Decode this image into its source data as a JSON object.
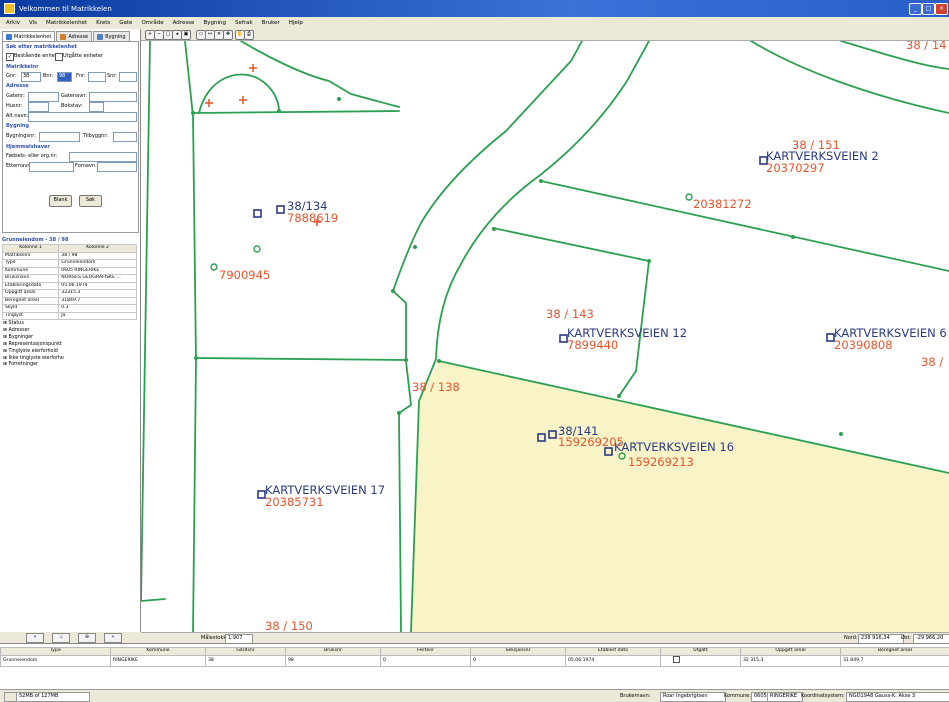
{
  "titlebar": {
    "title": "Velkommen til Matrikkelen"
  },
  "menu": [
    "Arkiv",
    "Vis",
    "Matrikkelenhet",
    "Krets",
    "Gate",
    "Område",
    "Adresse",
    "Bygning",
    "Sefrak",
    "Bruker",
    "Hjelp"
  ],
  "tabs": [
    "Matrikkelenhet",
    "Adresse",
    "Bygning"
  ],
  "search": {
    "heading": "Søk etter matrikkelenhet",
    "opt_existing": "Bestående enheter",
    "opt_expired": "Utgåtte enheter",
    "matrikkel_head": "Matrikkelnr",
    "gnr_label": "Gnr:",
    "gnr_value": "38",
    "bnr_label": "Bnr:",
    "bnr_value": "98",
    "fnr_label": "Fnr:",
    "snr_label": "Snr:",
    "adresse_head": "Adresse",
    "gatenr_label": "Gatenr:",
    "gatenavn_label": "Gatenavn:",
    "husnr_label": "Husnr:",
    "bokstav_label": "Bokstav:",
    "altnavn_label": "Alt.navn:",
    "bygning_head": "Bygning",
    "bygningsnr_label": "Bygningsnr:",
    "tilbygg_label": "Tilbyggnr:",
    "hjemmelshaver_head": "Hjemmelshaver",
    "fodsels_label": "Fødsels- eller org.nr:",
    "etternavn_label": "Etternavn:",
    "fornavn_label": "Fornavn:",
    "blank_button": "Blank",
    "search_button": "Søk"
  },
  "result": {
    "header": "Grunneiendom - 38 / 98",
    "col1": "Kolonne 1",
    "col2": "Kolonne 2",
    "rows": [
      [
        "Matrikkelnr",
        "38 / 98"
      ],
      [
        "Type",
        "Grunneiendom"
      ],
      [
        "Kommune",
        "0605 RINGERIKE"
      ],
      [
        "Bruksnavn",
        "NORGES GEOGRAFISKE ..."
      ],
      [
        "Etableringsdato",
        "05.06.1974"
      ],
      [
        "Oppgitt areal",
        "32315.3"
      ],
      [
        "Beregnet areal",
        "31849.7"
      ],
      [
        "Skyld",
        "0.3"
      ],
      [
        "Tinglyst",
        "Ja"
      ]
    ],
    "tree": [
      "Status",
      "Adresser",
      "Bygninger",
      "Representasjonspunkt",
      "Tinglyste eierforhold",
      "Ikke tinglyste eierforho",
      "Forretninger"
    ]
  },
  "nav": [
    "«",
    "⊥",
    "⊕",
    "»"
  ],
  "map_labels": {
    "parcels": [
      "38 / 14",
      "38 / 151",
      "38 / 143",
      "38 / 138",
      "38 / 150",
      "38 /",
      "38/134",
      "38/141"
    ],
    "addresses": [
      "KARTVERKSVEIEN 2",
      "KARTVERKSVEIEN 12",
      "KARTVERKSVEIEN 6",
      "KARTVERKSVEIEN 16",
      "KARTVERKSVEIEN 17"
    ],
    "ids": [
      "20370297",
      "20381272",
      "7888619",
      "7900945",
      "7899440",
      "20390808",
      "159269205",
      "159269213",
      "20385731"
    ]
  },
  "mapstatus": {
    "scale_label": "Målestokk:",
    "scale_value": "1:907",
    "nord_label": "Nord:",
    "nord_value": "238 916,34",
    "ost_label": "Øst:",
    "ost_value": "-29 966,20"
  },
  "grid": {
    "headers": [
      "Type",
      "Kommune",
      "Gårdsnr",
      "Bruksnr",
      "Festenr",
      "Seksjonsnr",
      "Etablert dato",
      "Utgått",
      "Oppgitt areal",
      "Beregnet areal"
    ],
    "row": [
      "Grunneiendom",
      "RINGERIKE",
      "38",
      "98",
      "0",
      "0",
      "05.06.1974",
      "",
      "32 315,3",
      "31 849,7"
    ]
  },
  "statusbar": {
    "memory": "52MB of 127MB",
    "bruker_label": "Brukernavn:",
    "bruker_value": "Roar Ingebrigtsen",
    "kommune_label": "Kommune:",
    "kommune_code": "0605",
    "kommune_name": "RINGERIKE",
    "koord_label": "Koordinatsystem:",
    "koord_value": "NGO1948 Gauss-K. Akse 3"
  },
  "colors": {
    "parcel_line": "#2aa050",
    "yellow_fill": "#f8f4c8",
    "label_red": "#e8542c",
    "label_blue": "#2a3a80"
  }
}
